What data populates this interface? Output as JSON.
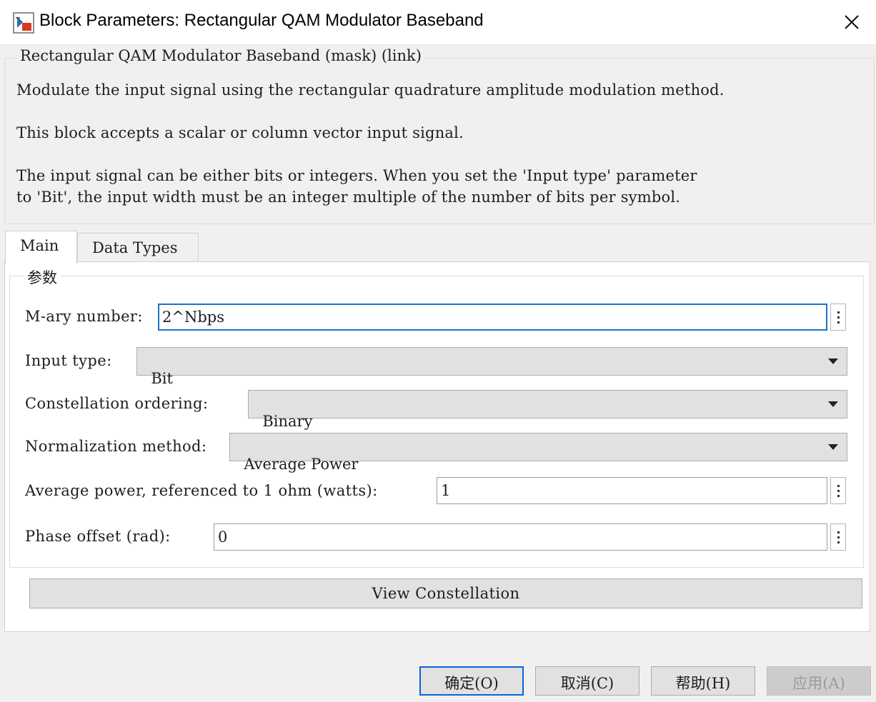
{
  "window": {
    "title": "Block Parameters: Rectangular QAM Modulator Baseband",
    "app_icon": "simulink-block-icon",
    "close_icon": "close-icon"
  },
  "mask": {
    "legend": "Rectangular QAM Modulator Baseband (mask) (link)",
    "description": [
      "Modulate the input signal using the rectangular quadrature amplitude modulation method.",
      "This block accepts a scalar or column vector input signal.",
      "The input signal can be either bits or integers. When you set the 'Input type' parameter",
      "to 'Bit', the input width must be an integer multiple of the number of bits per symbol."
    ]
  },
  "tabs": [
    {
      "label": "Main",
      "selected": true
    },
    {
      "label": "Data Types",
      "selected": false
    }
  ],
  "parameters": {
    "group_label": "参数",
    "mary": {
      "label": "M-ary number:",
      "value": "2^Nbps"
    },
    "input_type": {
      "label": "Input type:",
      "value": "Bit"
    },
    "constellation_ordering": {
      "label": "Constellation ordering:",
      "value": "Binary"
    },
    "normalization_method": {
      "label": "Normalization method:",
      "value": "Average Power"
    },
    "average_power": {
      "label": "Average power, referenced to 1 ohm (watts):",
      "value": "1"
    },
    "phase_offset": {
      "label": "Phase offset (rad):",
      "value": "0"
    },
    "view_constellation": "View Constellation"
  },
  "buttons": {
    "ok": "确定(O)",
    "cancel": "取消(C)",
    "help": "帮助(H)",
    "apply": "应用(A)"
  },
  "colors": {
    "focus_border": "#1a73c9",
    "default_button_border": "#0a64d6",
    "dialog_background": "#f0f0f0"
  }
}
